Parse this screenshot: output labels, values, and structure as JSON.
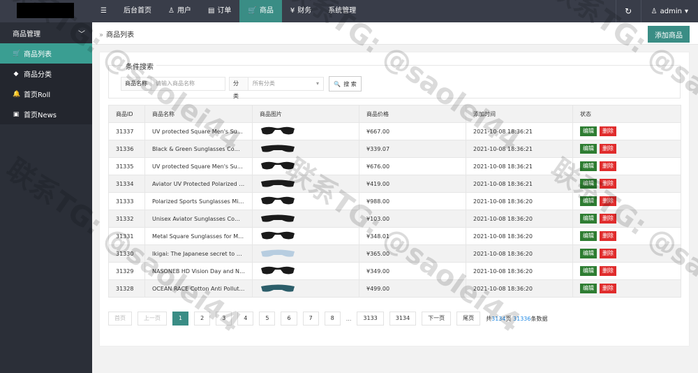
{
  "nav": [
    {
      "id": "menu",
      "label": "",
      "icon": "☰"
    },
    {
      "id": "home",
      "label": "后台首页",
      "icon": ""
    },
    {
      "id": "users",
      "label": "用户",
      "icon": "♙"
    },
    {
      "id": "orders",
      "label": "订单",
      "icon": "▤"
    },
    {
      "id": "goods",
      "label": "商品",
      "icon": "🛒"
    },
    {
      "id": "finance",
      "label": "财务",
      "icon": "¥"
    },
    {
      "id": "system",
      "label": "系统管理",
      "icon": ""
    }
  ],
  "top_right": {
    "refresh_icon": "↻",
    "user_icon": "♙",
    "user_name": "admin",
    "caret": "▾"
  },
  "sidebar": {
    "group_label": "商品管理",
    "group_caret": "﹀",
    "items": [
      {
        "label": "商品列表",
        "icon": "🛒"
      },
      {
        "label": "商品分类",
        "icon": "◆"
      },
      {
        "label": "首页Roll",
        "icon": "🔔"
      },
      {
        "label": "首页News",
        "icon": "▣"
      }
    ]
  },
  "breadcrumb": {
    "sep": "»",
    "label": "商品列表"
  },
  "add_button": "添加商品",
  "search": {
    "legend": "条件搜索",
    "name_label": "商品名称",
    "name_placeholder": "请输入商品名称",
    "cat_label": "分类",
    "cat_value": "所有分类",
    "cat_caret": "▾",
    "button": "搜 索",
    "button_icon": "🔍"
  },
  "table": {
    "headers": [
      "商品ID",
      "商品名称",
      "商品图片",
      "商品价格",
      "添加时间",
      "状态"
    ],
    "edit_label": "编辑",
    "delete_label": "删除",
    "rows": [
      {
        "id": "31337",
        "name": "UV protected Square Men's Sunglasses",
        "price": "¥667.00",
        "time": "2021-10-08 18:36:21"
      },
      {
        "id": "31336",
        "name": "Black & Green Sunglasses Combo",
        "price": "¥339.07",
        "time": "2021-10-08 18:36:21"
      },
      {
        "id": "31335",
        "name": "UV protected Square Men's Sunglasses",
        "price": "¥676.00",
        "time": "2021-10-08 18:36:21"
      },
      {
        "id": "31334",
        "name": "Aviator UV Protected Polarized Black",
        "price": "¥419.00",
        "time": "2021-10-08 18:36:21"
      },
      {
        "id": "31333",
        "name": "Polarized Sports Sunglasses Mirror Lens",
        "price": "¥988.00",
        "time": "2021-10-08 18:36:20"
      },
      {
        "id": "31332",
        "name": "Unisex Aviator Sunglasses Combo (Pack)",
        "price": "¥103.00",
        "time": "2021-10-08 18:36:20"
      },
      {
        "id": "31331",
        "name": "Metal Square Sunglasses for Men and Women",
        "price": "¥348.01",
        "time": "2021-10-08 18:36:20"
      },
      {
        "id": "31330",
        "name": "Ikigai: The Japanese secret to a long life",
        "price": "¥365.00",
        "time": "2021-10-08 18:36:20"
      },
      {
        "id": "31329",
        "name": "NASONEB HD Vision Day and Night Glasses",
        "price": "¥349.00",
        "time": "2021-10-08 18:36:20"
      },
      {
        "id": "31328",
        "name": "OCEAN RACE Cotton Anti Pollution Mask",
        "price": "¥499.00",
        "time": "2021-10-08 18:36:20"
      }
    ]
  },
  "pager": {
    "first": "首页",
    "prev": "上一页",
    "pages": [
      "1",
      "2",
      "3",
      "4",
      "5",
      "6",
      "7",
      "8"
    ],
    "current": "1",
    "dots": "...",
    "tail": [
      "3133",
      "3134"
    ],
    "next": "下一页",
    "last": "尾页",
    "total_prefix": "共",
    "total_pages": "3134",
    "total_mid": "页 ",
    "total_count": "31336",
    "total_suffix": "条数据"
  },
  "watermark": "联系TG: @saolei44",
  "colors": {
    "accent": "#3a8d85",
    "topbar": "#393d49",
    "sidebar": "#2b2f38",
    "edit": "#2e7d32",
    "delete": "#e02c2c"
  }
}
